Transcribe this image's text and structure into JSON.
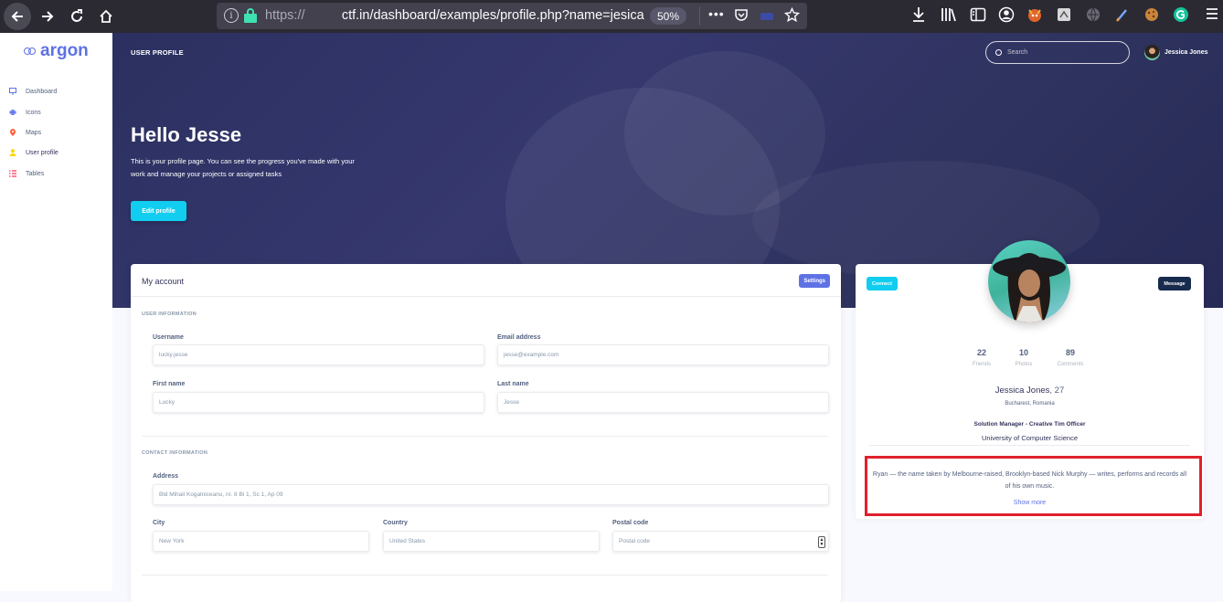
{
  "browser": {
    "url_scheme": "https://",
    "url_host_hidden": "          ",
    "url_rest": "ctf.in/dashboard/examples/profile.php?name=jesica",
    "zoom": "50%",
    "more": "•••"
  },
  "sidebar": {
    "logo": "argon",
    "items": [
      {
        "label": "Dashboard",
        "color": "#5e72e4"
      },
      {
        "label": "Icons",
        "color": "#5e72e4"
      },
      {
        "label": "Maps",
        "color": "#fb6340"
      },
      {
        "label": "User profile",
        "color": "#ffd600"
      },
      {
        "label": "Tables",
        "color": "#f5365c"
      }
    ]
  },
  "topbar": {
    "title": "USER PROFILE",
    "search_placeholder": "Search",
    "user_name": "Jessica Jones"
  },
  "hero": {
    "heading": "Hello Jesse",
    "text": "This is your profile page. You can see the progress you've made with your work and manage your projects or assigned tasks",
    "edit_button": "Edit profile"
  },
  "account": {
    "title": "My account",
    "settings_button": "Settings",
    "user_info_label": "USER INFORMATION",
    "username_label": "Username",
    "username_value": "lucky.jesse",
    "email_label": "Email address",
    "email_placeholder": "jesse@example.com",
    "first_name_label": "First name",
    "first_name_value": "Lucky",
    "last_name_label": "Last name",
    "last_name_value": "Jesse",
    "contact_label": "CONTACT INFORMATION",
    "address_label": "Address",
    "address_value": "Bld Mihail Kogalniceanu, nr. 8 Bl 1, Sc 1, Ap 09",
    "city_label": "City",
    "city_value": "New York",
    "country_label": "Country",
    "country_value": "United States",
    "postal_label": "Postal code",
    "postal_placeholder": "Postal code"
  },
  "profile": {
    "connect_button": "Connect",
    "message_button": "Message",
    "stats": [
      {
        "value": "22",
        "label": "Friends"
      },
      {
        "value": "10",
        "label": "Photos"
      },
      {
        "value": "89",
        "label": "Comments"
      }
    ],
    "name": "Jessica Jones",
    "age": ", 27",
    "location": "Bucharest, Romania",
    "job": "Solution Manager - Creative Tim Officer",
    "school": "University of Computer Science",
    "bio": "Ryan — the name taken by Melbourne-raised, Brooklyn-based Nick Murphy — writes, performs and records all of his own music.",
    "show_more": "Show more"
  }
}
